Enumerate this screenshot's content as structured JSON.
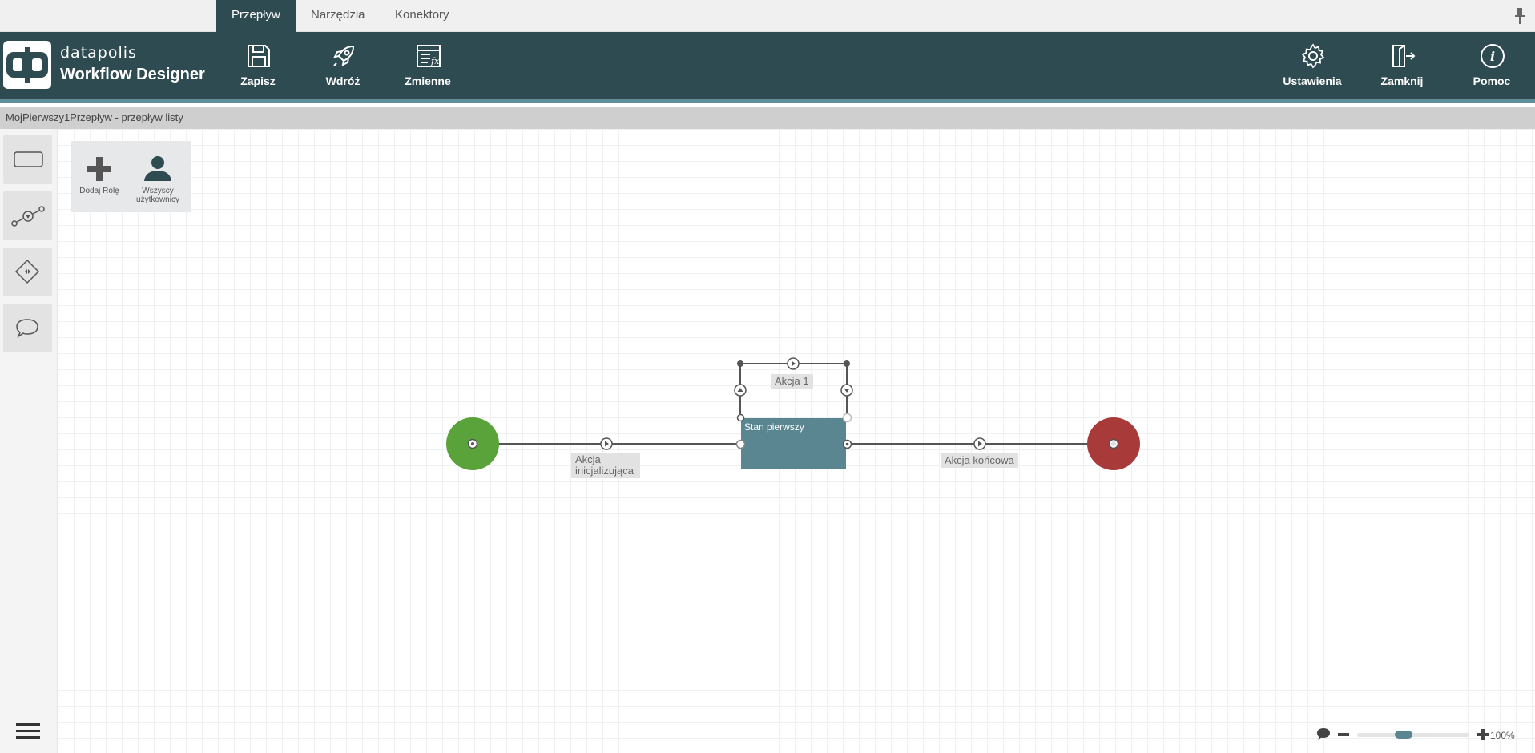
{
  "tabs": [
    {
      "label": "Przepływ",
      "active": true
    },
    {
      "label": "Narzędzia",
      "active": false
    },
    {
      "label": "Konektory",
      "active": false
    }
  ],
  "brand": {
    "company": "datapolis",
    "product": "Workflow Designer"
  },
  "ribbon": {
    "left": [
      {
        "label": "Zapisz",
        "icon": "save-icon"
      },
      {
        "label": "Wdróż",
        "icon": "rocket-icon"
      },
      {
        "label": "Zmienne",
        "icon": "variables-icon"
      }
    ],
    "right": [
      {
        "label": "Ustawienia",
        "icon": "gear-icon"
      },
      {
        "label": "Zamknij",
        "icon": "exit-icon"
      },
      {
        "label": "Pomoc",
        "icon": "info-icon"
      }
    ]
  },
  "breadcrumb": "MojPierwszy1Przepływ - przepływ listy",
  "palette": [
    "state-tool-icon",
    "transition-tool-icon",
    "condition-tool-icon",
    "comment-tool-icon"
  ],
  "roles": [
    {
      "label": "Dodaj Rolę",
      "icon": "plus-icon"
    },
    {
      "label": "Wszyscy użytkownicy",
      "icon": "user-icon"
    }
  ],
  "diagram": {
    "start_color": "#5aa33a",
    "end_color": "#a93a3a",
    "state_color": "#5a8691",
    "state_title": "Stan pierwszy",
    "init_action": "Akcja inicjalizująca",
    "loop_action": "Akcja 1",
    "end_action": "Akcja końcowa"
  },
  "zoom": {
    "level": "100%"
  }
}
